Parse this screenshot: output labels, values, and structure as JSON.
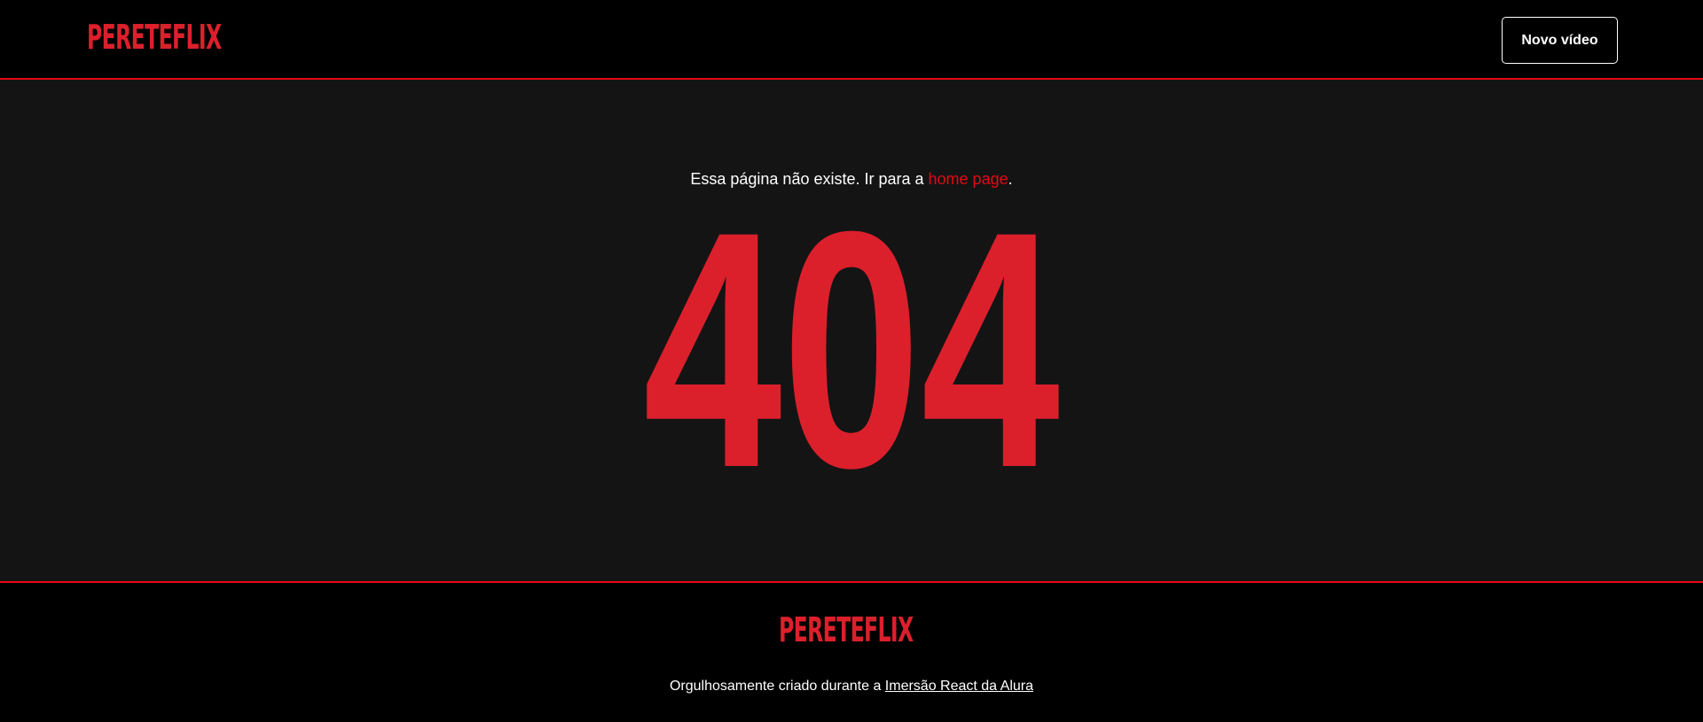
{
  "header": {
    "logo_text": "PERETEFLIX",
    "new_video_label": "Novo vídeo"
  },
  "main": {
    "message_prefix": "Essa página não existe. Ir para a ",
    "home_link_label": "home page",
    "message_suffix": ".",
    "error_code": "404"
  },
  "footer": {
    "logo_text": "PERETEFLIX",
    "credit_prefix": "Orgulhosamente criado durante a ",
    "credit_link_label": "Imersão React da Alura"
  },
  "colors": {
    "brand_red": "#db202c",
    "accent_red": "#e50914",
    "header_background": "#000000",
    "page_background": "#141414",
    "text": "#ffffff"
  }
}
